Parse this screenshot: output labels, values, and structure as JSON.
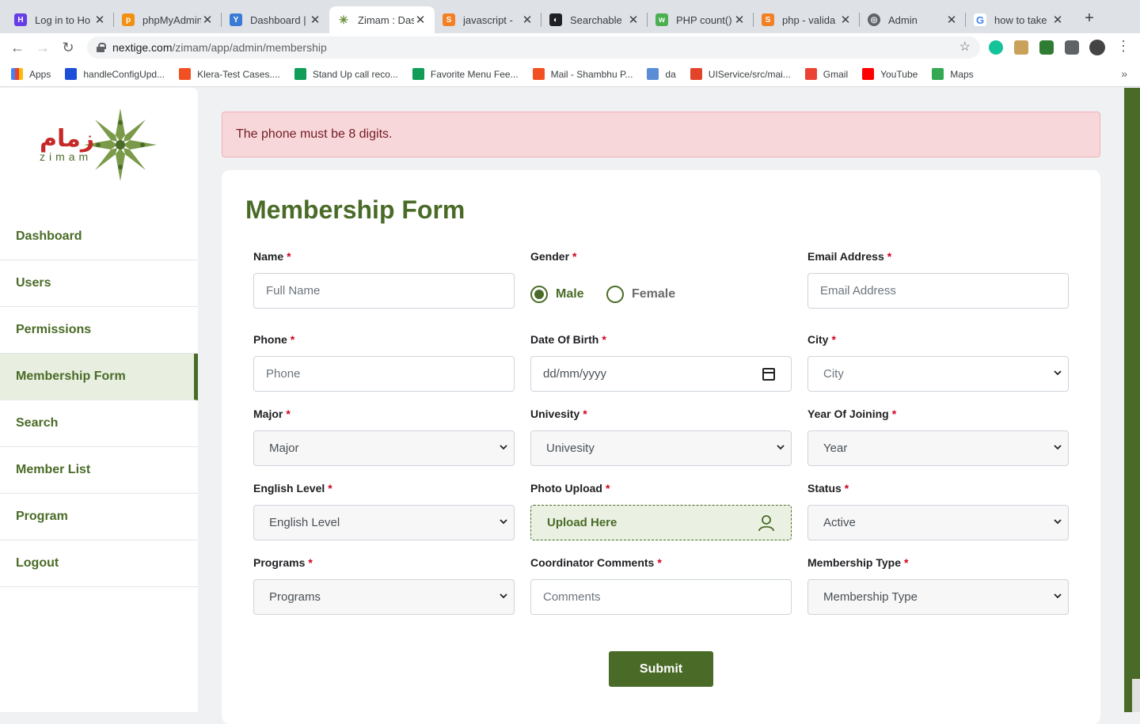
{
  "browser": {
    "tabs": [
      {
        "title": "Log in to Ho",
        "icon": "hostinger-icon",
        "color": "#673de6"
      },
      {
        "title": "phpMyAdmin",
        "icon": "phpmyadmin-icon",
        "color": "#f29111"
      },
      {
        "title": "Dashboard |",
        "icon": "dashboard-icon",
        "color": "#3a7bd5"
      },
      {
        "title": "Zimam : Das",
        "icon": "zimam-icon",
        "color": "#6a8e3a",
        "active": true
      },
      {
        "title": "javascript - ",
        "icon": "stackoverflow-icon",
        "color": "#f48024"
      },
      {
        "title": "Searchable ",
        "icon": "searchable-icon",
        "color": "#202124"
      },
      {
        "title": "PHP count()",
        "icon": "w3schools-icon",
        "color": "#4caf50"
      },
      {
        "title": "php - valida",
        "icon": "stackoverflow-icon",
        "color": "#f48024"
      },
      {
        "title": "Admin",
        "icon": "globe-icon",
        "color": "#5f6368"
      },
      {
        "title": "how to take ",
        "icon": "google-icon",
        "color": "#4285f4"
      }
    ],
    "url_host": "nextige.com",
    "url_path": "/zimam/app/admin/membership",
    "bookmarks": [
      {
        "label": "Apps",
        "color": "#4285f4"
      },
      {
        "label": "handleConfigUpd...",
        "color": "#1d4ed8"
      },
      {
        "label": "Klera-Test Cases....",
        "color": "#f25022"
      },
      {
        "label": "Stand Up call reco...",
        "color": "#0f9d58"
      },
      {
        "label": "Favorite Menu Fee...",
        "color": "#0f9d58"
      },
      {
        "label": "Mail - Shambhu P...",
        "color": "#f25022"
      },
      {
        "label": "da",
        "color": "#5b8dd6"
      },
      {
        "label": "UIService/src/mai...",
        "color": "#e24329"
      },
      {
        "label": "Gmail",
        "color": "#ea4335"
      },
      {
        "label": "YouTube",
        "color": "#ff0000"
      },
      {
        "label": "Maps",
        "color": "#34a853"
      }
    ]
  },
  "brand": {
    "logo_arabic": "زمام",
    "logo_latin": "zimam"
  },
  "sidebar": {
    "items": [
      {
        "label": "Dashboard"
      },
      {
        "label": "Users"
      },
      {
        "label": "Permissions"
      },
      {
        "label": "Membership Form",
        "active": true
      },
      {
        "label": "Search"
      },
      {
        "label": "Member List"
      },
      {
        "label": "Program"
      },
      {
        "label": "Logout"
      }
    ]
  },
  "alert": {
    "message": "The phone must be 8 digits."
  },
  "form": {
    "title": "Membership Form",
    "name": {
      "label": "Name",
      "placeholder": "Full Name"
    },
    "gender": {
      "label": "Gender",
      "options": [
        "Male",
        "Female"
      ],
      "selected": "Male"
    },
    "email": {
      "label": "Email Address",
      "placeholder": "Email Address"
    },
    "phone": {
      "label": "Phone",
      "placeholder": "Phone"
    },
    "dob": {
      "label": "Date Of Birth",
      "placeholder": "dd/mm/yyyy"
    },
    "city": {
      "label": "City",
      "value": "City"
    },
    "major": {
      "label": "Major",
      "value": "Major"
    },
    "university": {
      "label": "Univesity",
      "value": "Univesity"
    },
    "year": {
      "label": "Year Of Joining",
      "value": "Year"
    },
    "english": {
      "label": "English Level",
      "value": "English Level"
    },
    "photo": {
      "label": "Photo Upload",
      "button": "Upload Here"
    },
    "status": {
      "label": "Status",
      "value": "Active"
    },
    "programs": {
      "label": "Programs",
      "value": "Programs"
    },
    "comments": {
      "label": "Coordinator Comments",
      "placeholder": "Comments"
    },
    "membership_type": {
      "label": "Membership Type",
      "value": "Membership Type"
    },
    "required_mark": "*",
    "submit": "Submit"
  },
  "colors": {
    "accent": "#4a6b27",
    "alert_bg": "#f8d7da",
    "alert_text": "#721c24",
    "required": "#d0021b"
  }
}
